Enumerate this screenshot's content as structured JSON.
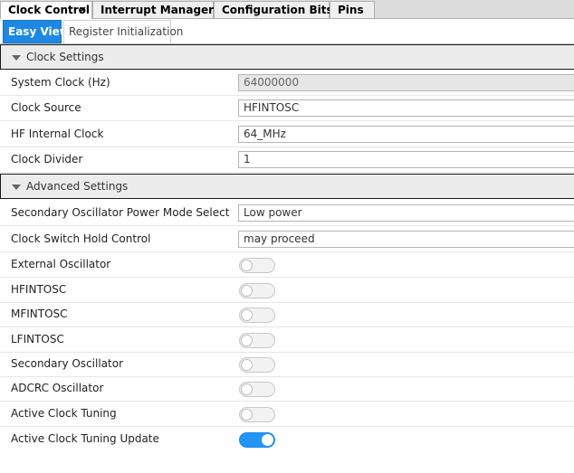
{
  "tabs": [
    {
      "label": "Clock Control",
      "close": "×"
    },
    {
      "label": "Interrupt Manager"
    },
    {
      "label": "Configuration Bits"
    },
    {
      "label": "Pins"
    }
  ],
  "subtabs": {
    "easy_view": "Easy View",
    "register_init": "Register Initialization"
  },
  "clock_settings": {
    "header": "Clock Settings",
    "system_clock": {
      "label": "System Clock (Hz)",
      "value": "64000000"
    },
    "clock_source": {
      "label": "Clock Source",
      "value": "HFINTOSC"
    },
    "hf_internal_clock": {
      "label": "HF Internal Clock",
      "value": "64_MHz"
    },
    "clock_divider": {
      "label": "Clock Divider",
      "value": "1"
    }
  },
  "advanced_settings": {
    "header": "Advanced Settings",
    "sec_osc_power": {
      "label": "Secondary Oscillator Power Mode Select",
      "value": "Low power"
    },
    "clock_switch_hold": {
      "label": "Clock Switch Hold Control",
      "value": "may proceed"
    },
    "toggles": [
      {
        "label": "External Oscillator",
        "on": false
      },
      {
        "label": "HFINTOSC",
        "on": false
      },
      {
        "label": "MFINTOSC",
        "on": false
      },
      {
        "label": "LFINTOSC",
        "on": false
      },
      {
        "label": "Secondary Oscillator",
        "on": false
      },
      {
        "label": "ADCRC Oscillator",
        "on": false
      },
      {
        "label": "Active Clock Tuning",
        "on": false
      },
      {
        "label": "Active Clock Tuning Update",
        "on": true
      }
    ]
  },
  "colors": {
    "accent": "#1e88e5",
    "toggle_on": "#2196f3"
  }
}
